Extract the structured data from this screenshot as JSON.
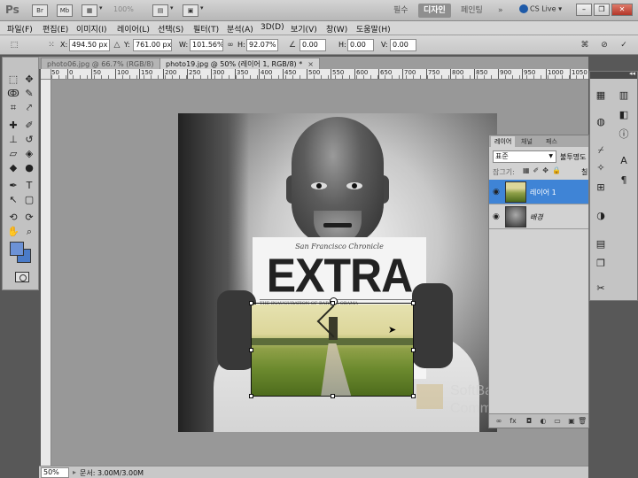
{
  "titlebar": {
    "app_logo": "Ps",
    "zoom_value": "100%",
    "workspaces": [
      "필수",
      "디자인",
      "페인팅"
    ],
    "active_workspace": "디자인",
    "more_icon": "chevrons-right-icon",
    "cs_live": "CS Live"
  },
  "menu": {
    "items": [
      "파일(F)",
      "편집(E)",
      "이미지(I)",
      "레이어(L)",
      "선택(S)",
      "필터(T)",
      "분석(A)",
      "3D(D)",
      "보기(V)",
      "창(W)",
      "도움말(H)"
    ]
  },
  "options": {
    "x_label": "X:",
    "x_value": "494.50 px",
    "y_label": "Y:",
    "y_value": "761.00 px",
    "w_label": "W:",
    "w_value": "101.56%",
    "h_label": "H:",
    "h_value": "92.07%",
    "angle_value": "0.00",
    "hskew_label": "H:",
    "hskew_value": "0.00",
    "vskew_label": "V:",
    "vskew_value": "0.00"
  },
  "tabs": [
    {
      "label": "photo06.jpg @ 66.7% (RGB/8)",
      "close": "×"
    },
    {
      "label": "photo19.jpg @ 50% (레이어 1, RGB/8) *",
      "close": "×"
    }
  ],
  "ruler": {
    "top_labels": [
      "50",
      "0",
      "50",
      "100",
      "150",
      "200",
      "250",
      "300",
      "350",
      "400",
      "450",
      "500",
      "550",
      "600",
      "650",
      "700",
      "750",
      "800",
      "850",
      "900",
      "950",
      "1000",
      "1050"
    ]
  },
  "newspaper": {
    "masthead": "San Francisco Chronicle",
    "headline": "EXTRA",
    "subline": "THE INAUGURATION OF BARACK OBAMA"
  },
  "watermark": {
    "line1": "SoftBank",
    "line2": "Commerce Korea"
  },
  "layers_panel": {
    "tabs": [
      "레이어",
      "채널",
      "패스"
    ],
    "blend_mode": "표준",
    "opacity_label": "불투명도",
    "lock_label": "잠그기:",
    "fill_label": "칠",
    "layers": [
      {
        "name": "레이어 1",
        "selected": true
      },
      {
        "name": "배경",
        "selected": false
      }
    ]
  },
  "status": {
    "zoom": "50%",
    "doc_info": "문서: 3.00M/3.00M"
  },
  "colors": {
    "foreground": "#6c92d6",
    "background": "#4a7bc8",
    "selection": "#3f84d6"
  }
}
